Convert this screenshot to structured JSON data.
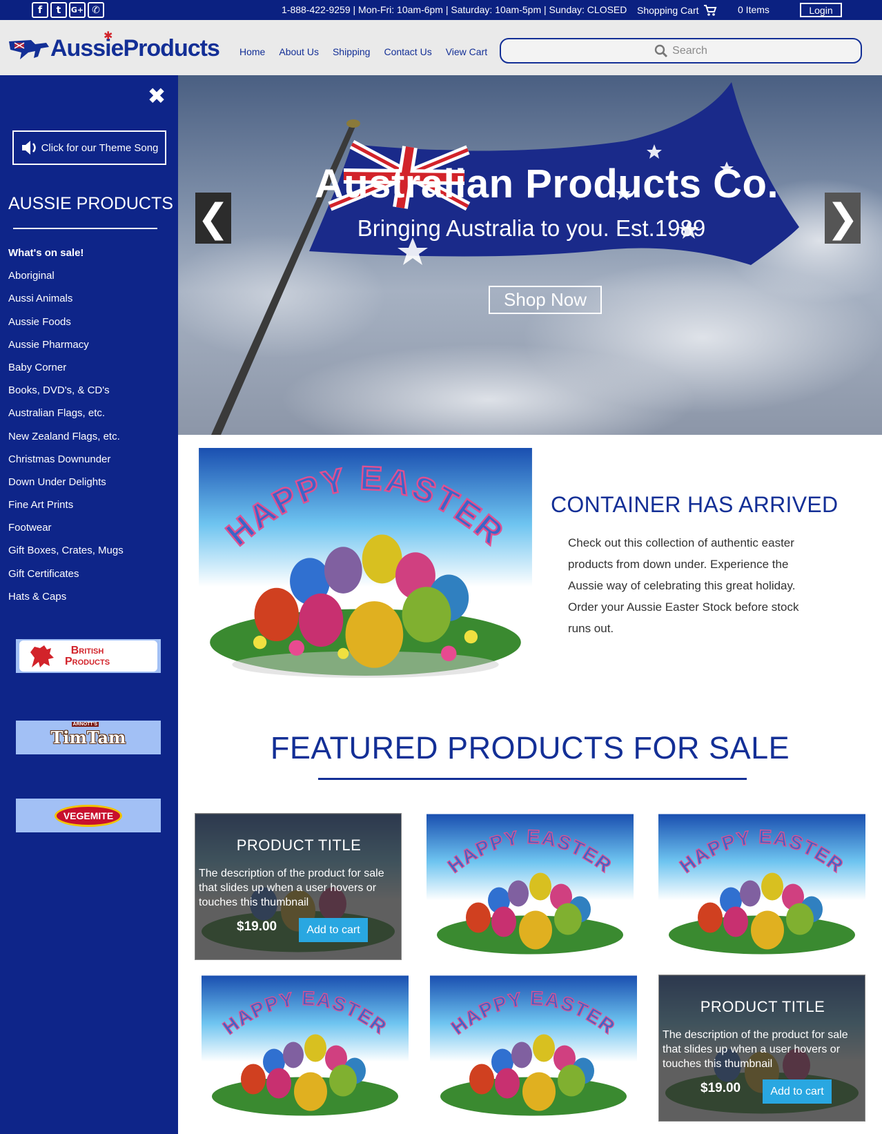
{
  "topbar": {
    "social_icons": [
      "facebook-icon",
      "twitter-icon",
      "google-plus-icon",
      "whatsapp-icon"
    ],
    "social_glyphs": [
      "f",
      "t",
      "G+",
      "✆"
    ],
    "contact_text": "1-888-422-9259  | Mon-Fri: 10am-6pm | Saturday: 10am-5pm | Sunday: CLOSED",
    "cart_label": "Shopping Cart",
    "items_label": "0 Items",
    "login_label": "Login"
  },
  "header": {
    "logo_text": "AussieProducts",
    "nav": [
      "Home",
      "About Us",
      "Shipping",
      "Contact Us",
      "View Cart"
    ],
    "search_placeholder": "Search"
  },
  "sidebar": {
    "close_glyph": "✖",
    "theme_button": "Click for our Theme Song",
    "title": "AUSSIE PRODUCTS",
    "items": [
      "What's on sale!",
      "Aboriginal",
      "Aussi Animals",
      "Aussie Foods",
      "Aussie Pharmacy",
      "Baby Corner",
      "Books, DVD's, & CD's",
      "Australian Flags, etc.",
      "New Zealand Flags, etc.",
      "Christmas Downunder",
      "Down Under Delights",
      "Fine Art Prints",
      "Footwear",
      "Gift Boxes, Crates, Mugs",
      "Gift Certificates",
      "Hats & Caps"
    ],
    "brands": {
      "british_line1": "British",
      "british_line2": "Products",
      "timtam": "TimTam",
      "timtam_small": "ARNOTT'S",
      "vegemite": "VEGEMITE"
    }
  },
  "hero": {
    "title": "Australian Products Co.",
    "subtitle": "Bringing Australia to you. Est.1989",
    "cta": "Shop Now",
    "prev_glyph": "❮",
    "next_glyph": "❯"
  },
  "container": {
    "image_text": "HAPPY EASTER",
    "title": "CONTAINER HAS ARRIVED",
    "text": "Check out this collection of authentic easter products from down under. Experience the Aussie way of celebrating this great holiday. Order your Aussie Easter Stock before stock runs out."
  },
  "featured": {
    "title": "FEATURED PRODUCTS FOR SALE",
    "product_title": "PRODUCT TITLE",
    "product_desc": "The description of the product for sale that slides up when a user hovers or touches this thumbnail",
    "price": "$19.00",
    "add_to_cart": "Add to cart"
  },
  "colors": {
    "brand_blue": "#0e2589",
    "accent_cyan": "#29a7e1",
    "flag_red": "#d2232a"
  }
}
